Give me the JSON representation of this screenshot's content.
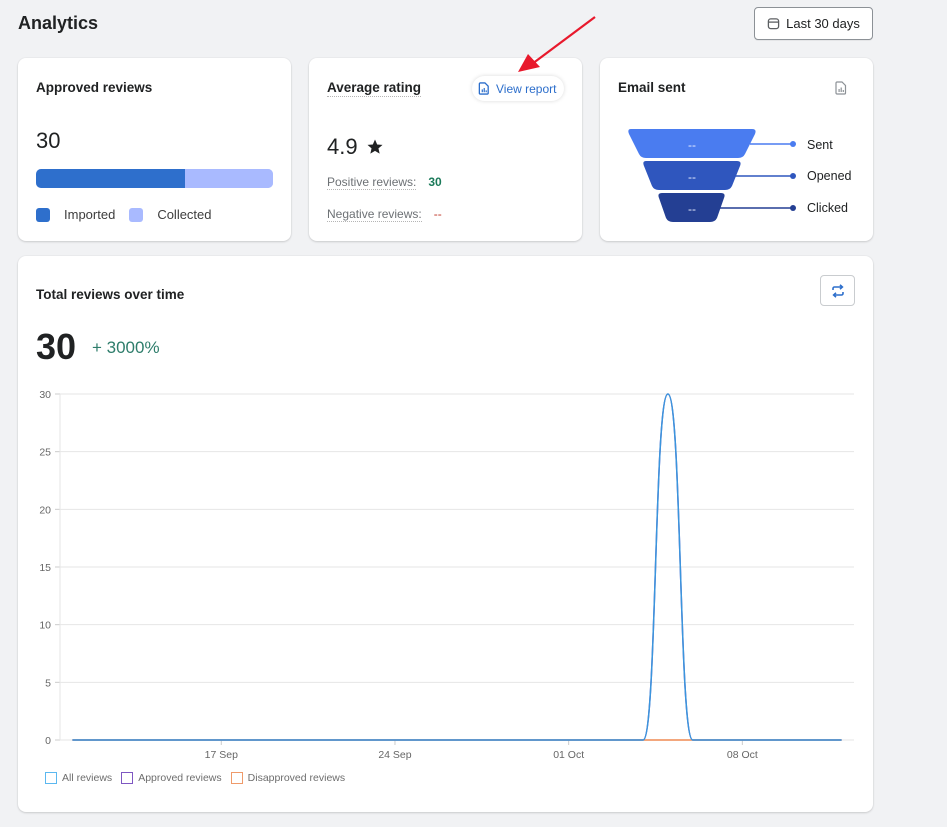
{
  "header": {
    "title": "Analytics",
    "date_range_label": "Last 30 days",
    "date_range_icon": "calendar-icon"
  },
  "approved_reviews": {
    "title": "Approved reviews",
    "total": "30",
    "imported_fraction": 0.63,
    "legend": [
      {
        "label": "Imported",
        "color": "#2e6fcc"
      },
      {
        "label": "Collected",
        "color": "#a9baff"
      }
    ]
  },
  "average_rating": {
    "title": "Average rating",
    "view_report_label": "View report",
    "value": "4.9",
    "star_icon": "star-icon",
    "positive_label": "Positive reviews:",
    "positive_value": "30",
    "negative_label": "Negative reviews:",
    "negative_value": "--"
  },
  "email_sent": {
    "title": "Email sent",
    "stages": [
      {
        "label": "Sent",
        "value": "--",
        "color": "#4a7cf0"
      },
      {
        "label": "Opened",
        "value": "--",
        "color": "#2f56be"
      },
      {
        "label": "Clicked",
        "value": "--",
        "color": "#243f93"
      }
    ]
  },
  "total_reviews": {
    "title": "Total reviews over time",
    "total": "30",
    "change": "+ 3000%"
  },
  "chart_data": {
    "type": "line",
    "title": "Total reviews over time",
    "xlabel": "",
    "ylabel": "",
    "x_range": [
      "11 Sep",
      "12 Oct"
    ],
    "x_ticks": [
      "17 Sep",
      "24 Sep",
      "01 Oct",
      "08 Oct"
    ],
    "y_ticks": [
      0,
      5,
      10,
      15,
      20,
      25,
      30
    ],
    "ylim": [
      0,
      30
    ],
    "grid": true,
    "legend_position": "bottom-left",
    "x": [
      "11 Sep",
      "12 Sep",
      "13 Sep",
      "14 Sep",
      "15 Sep",
      "16 Sep",
      "17 Sep",
      "18 Sep",
      "19 Sep",
      "20 Sep",
      "21 Sep",
      "22 Sep",
      "23 Sep",
      "24 Sep",
      "25 Sep",
      "26 Sep",
      "27 Sep",
      "28 Sep",
      "29 Sep",
      "30 Sep",
      "01 Oct",
      "02 Oct",
      "03 Oct",
      "04 Oct",
      "05 Oct",
      "06 Oct",
      "07 Oct",
      "08 Oct",
      "09 Oct",
      "10 Oct",
      "11 Oct",
      "12 Oct"
    ],
    "series": [
      {
        "name": "All reviews",
        "color": "#3a96dd",
        "values": [
          0,
          0,
          0,
          0,
          0,
          0,
          0,
          0,
          0,
          0,
          0,
          0,
          0,
          0,
          0,
          0,
          0,
          0,
          0,
          0,
          0,
          0,
          0,
          0,
          30,
          0,
          0,
          0,
          0,
          0,
          0,
          0
        ]
      },
      {
        "name": "Approved reviews",
        "color": "#7e57c2",
        "values": [
          0,
          0,
          0,
          0,
          0,
          0,
          0,
          0,
          0,
          0,
          0,
          0,
          0,
          0,
          0,
          0,
          0,
          0,
          0,
          0,
          0,
          0,
          0,
          0,
          30,
          0,
          0,
          0,
          0,
          0,
          0,
          0
        ]
      },
      {
        "name": "Disapproved reviews",
        "color": "#ef8a52",
        "values": [
          0,
          0,
          0,
          0,
          0,
          0,
          0,
          0,
          0,
          0,
          0,
          0,
          0,
          0,
          0,
          0,
          0,
          0,
          0,
          0,
          0,
          0,
          0,
          0,
          0,
          0,
          0,
          0,
          0,
          0,
          0,
          0
        ]
      }
    ],
    "legend": [
      {
        "label": "All reviews",
        "color": "#5bb8f0"
      },
      {
        "label": "Approved reviews",
        "color": "#7e57c2"
      },
      {
        "label": "Disapproved reviews",
        "color": "#ef9a6a"
      }
    ]
  }
}
